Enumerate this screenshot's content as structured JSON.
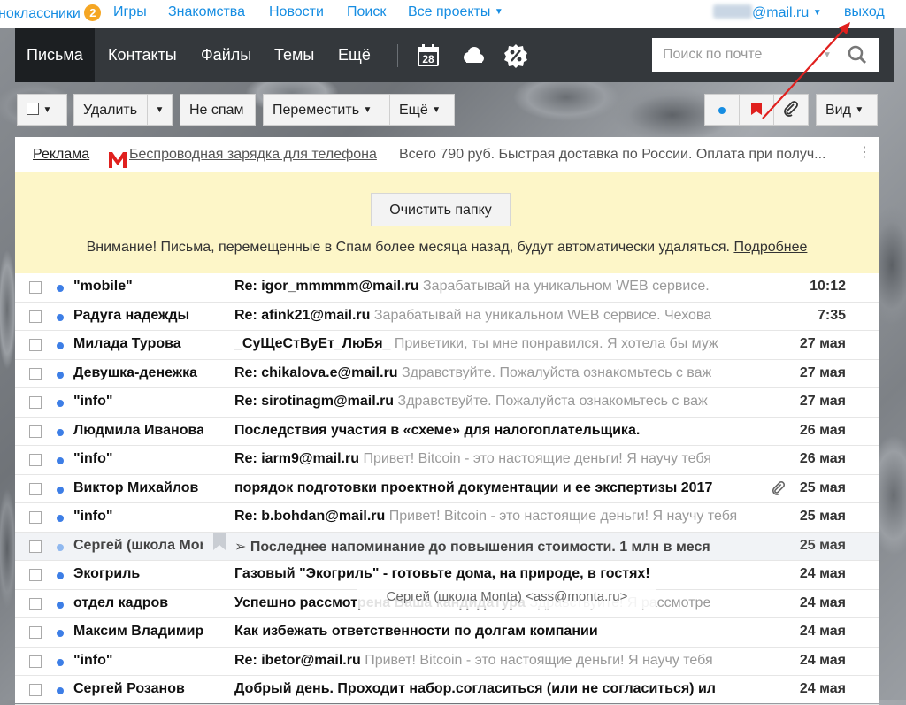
{
  "portal": {
    "odnoklassniki": "ноклассники",
    "badge_count": "2",
    "games": "Игры",
    "dating": "Знакомства",
    "news": "Новости",
    "search": "Поиск",
    "all_projects": "Все проекты",
    "email_domain": "@mail.ru",
    "logout": "выход"
  },
  "nav": {
    "tabs": [
      "Письма",
      "Контакты",
      "Файлы",
      "Темы",
      "Ещё"
    ],
    "active_tab": "Письма",
    "calendar_day": "28",
    "search_placeholder": "Поиск по почте"
  },
  "toolbar": {
    "delete": "Удалить",
    "not_spam": "Не спам",
    "move": "Переместить",
    "more": "Ещё",
    "view": "Вид"
  },
  "ad": {
    "label": "Реклама",
    "title": "Беспроводная зарядка для телефона",
    "text": "Всего 790 руб. Быстрая доставка по России. Оплата при получ...",
    "dots": "⋮"
  },
  "notice": {
    "clear_button": "Очистить папку",
    "warning": "Внимание! Письма, перемещенные в Спам более месяца назад, будут автоматически удаляться.",
    "more_link": "Подробнее"
  },
  "messages": [
    {
      "from": "\"mobile\"",
      "subject": "Re: igor_mmmmm@mail.ru",
      "snippet": "Зарабатывай на уникальном WEB сервисе.",
      "date": "10:12"
    },
    {
      "from": "Радуга надежды",
      "subject": "Re: afink21@mail.ru",
      "snippet": "Зарабатывай на уникальном WEB сервисе. Чехова",
      "date": "7:35"
    },
    {
      "from": "Милада Турова",
      "subject": "_СуЩеСтВуЕт_ЛюБя_",
      "snippet": "Приветики, ты мне понравился. Я хотела бы муж",
      "date": "27 мая"
    },
    {
      "from": "Девушка-денежка",
      "subject": "Re: chikalova.e@mail.ru",
      "snippet": "Здравствуйте. Пожалуйста ознакомьтесь с важ",
      "date": "27 мая"
    },
    {
      "from": "\"info\"",
      "subject": "Re: sirotinagm@mail.ru",
      "snippet": "Здравствуйте. Пожалуйста ознакомьтесь с важ",
      "date": "27 мая"
    },
    {
      "from": "Людмила Иванова",
      "subject": "Последствия участия в «схеме» для налогоплательщика.",
      "snippet": "",
      "date": "26 мая"
    },
    {
      "from": "\"info\"",
      "subject": "Re: iarm9@mail.ru",
      "snippet": "Привет! Bitcoin - это настоящие деньги! Я научу тебя",
      "date": "26 мая"
    },
    {
      "from": "Виктор Михайлов",
      "subject": "порядок подготовки проектной документации и ее экспертизы 2017",
      "snippet": "",
      "date": "25 мая"
    },
    {
      "from": "\"info\"",
      "subject": "Re: b.bohdan@mail.ru",
      "snippet": "Привет! Bitcoin - это настоящие деньги! Я научу тебя",
      "date": "25 мая"
    },
    {
      "from": "Сергей (школа Monta)",
      "subject": "➢ Последнее напоминание до повышения стоимости. 1 млн в меся",
      "snippet": "",
      "date": "25 мая"
    },
    {
      "from": "Экогриль",
      "subject": "Газовый \"Экогриль\" - готовьте дома, на природе, в гостях!",
      "snippet": "",
      "date": "24 мая"
    },
    {
      "from": "отдел кадров",
      "subject": "Успешно рассмотрена Ваша кандидатура",
      "snippet": "Здравствуйте! Я рассмотре",
      "date": "24 мая"
    },
    {
      "from": "Максим Владимиров",
      "subject": "Как избежать ответственности по долгам компании",
      "snippet": "",
      "date": "24 мая"
    },
    {
      "from": "\"info\"",
      "subject": "Re: ibetor@mail.ru",
      "snippet": "Привет! Bitcoin - это настоящие деньги! Я научу тебя",
      "date": "24 мая"
    },
    {
      "from": "Сергей Розанов",
      "subject": "Добрый день. Проходит набор.согласиться (или не согласиться) ил",
      "snippet": "",
      "date": "24 мая"
    }
  ],
  "tooltip": "Сергей (школа Monta) <ass@monta.ru>",
  "colors": {
    "link": "#168de2",
    "header_bg": "#34383c",
    "active_tab_bg": "#1c1f22",
    "notice_bg": "#fdf6c8",
    "unread_dot": "#3d7ee6",
    "flag_red": "#e0201e",
    "arrow_red": "#e0201e"
  }
}
